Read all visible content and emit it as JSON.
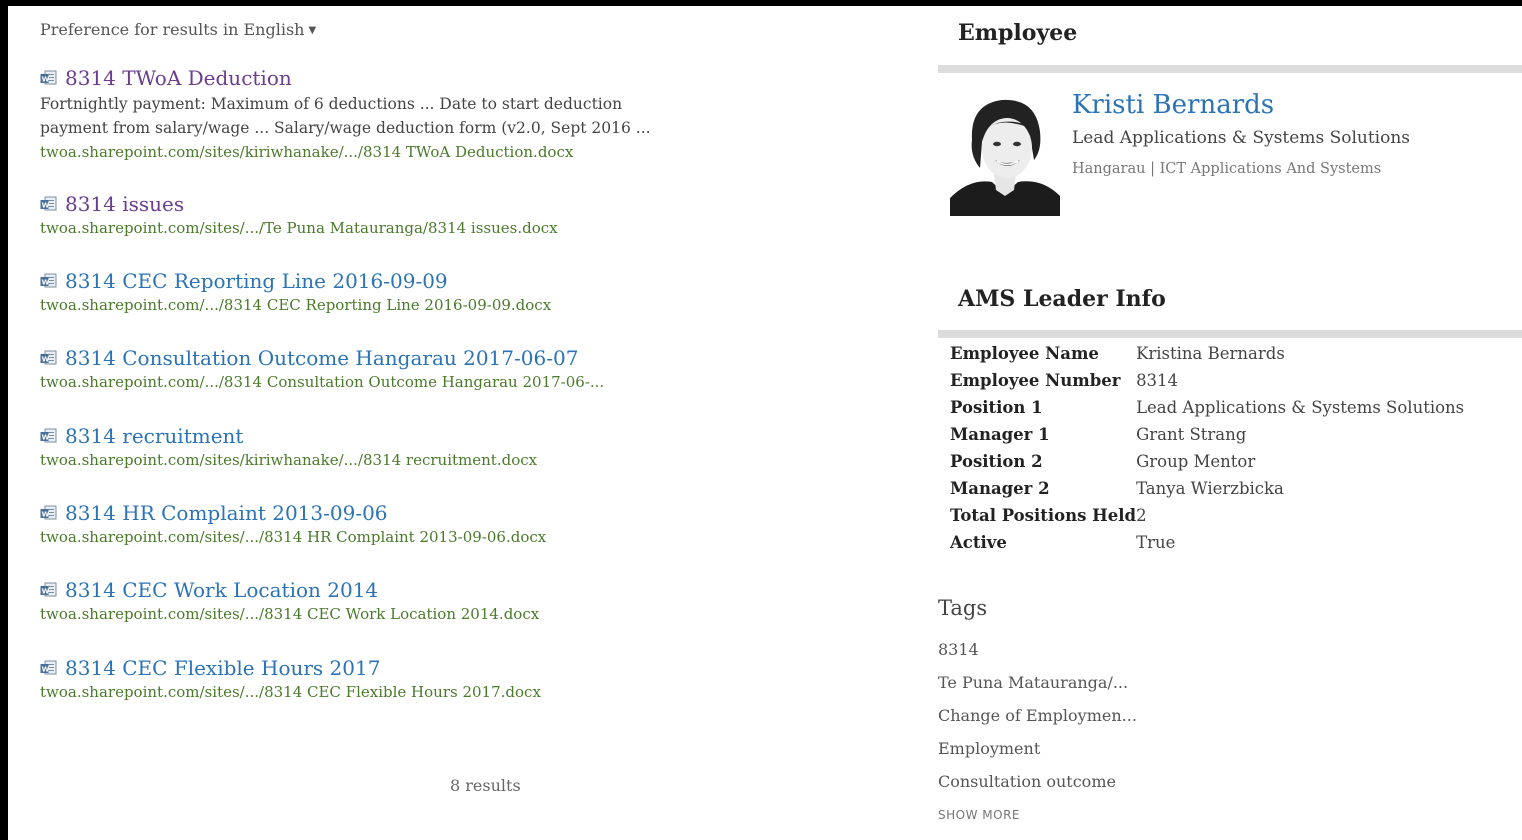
{
  "results_pane": {
    "preference_label": "Preference for results in English",
    "results": [
      {
        "title": "8314 TWoA Deduction",
        "visited": true,
        "snippet": [
          "Fortnightly payment: Maximum of 6 deductions ... Date to start deduction",
          "payment from salary/wage ... Salary/wage deduction form (v2.0, Sept 2016 ..."
        ],
        "url": "twoa.sharepoint.com/sites/kiriwhanake/.../8314 TWoA Deduction.docx"
      },
      {
        "title": "8314 issues",
        "visited": true,
        "snippet": [],
        "url": "twoa.sharepoint.com/sites/.../Te Puna Matauranga/8314 issues.docx"
      },
      {
        "title": "8314 CEC Reporting Line 2016-09-09",
        "visited": false,
        "snippet": [],
        "url": "twoa.sharepoint.com/.../8314 CEC Reporting Line 2016-09-09.docx"
      },
      {
        "title": "8314 Consultation Outcome Hangarau 2017-06-07",
        "visited": false,
        "snippet": [],
        "url": "twoa.sharepoint.com/.../8314 Consultation Outcome Hangarau 2017-06-..."
      },
      {
        "title": "8314 recruitment",
        "visited": false,
        "snippet": [],
        "url": "twoa.sharepoint.com/sites/kiriwhanake/.../8314 recruitment.docx"
      },
      {
        "title": "8314 HR Complaint 2013-09-06",
        "visited": false,
        "snippet": [],
        "url": "twoa.sharepoint.com/sites/.../8314 HR Complaint 2013-09-06.docx"
      },
      {
        "title": "8314 CEC Work Location 2014",
        "visited": false,
        "snippet": [],
        "url": "twoa.sharepoint.com/sites/.../8314 CEC Work Location 2014.docx"
      },
      {
        "title": "8314 CEC Flexible Hours 2017",
        "visited": false,
        "snippet": [],
        "url": "twoa.sharepoint.com/sites/.../8314 CEC Flexible Hours 2017.docx"
      }
    ],
    "result_count": "8 results",
    "icon": "word-document-icon"
  },
  "employee_pane": {
    "heading": "Employee",
    "name": "Kristi Bernards",
    "title": "Lead Applications & Systems Solutions",
    "department": "Hangarau | ICT Applications And Systems",
    "ams_heading": "AMS Leader Info",
    "info": [
      {
        "key": "Employee Name",
        "value": "Kristina Bernards"
      },
      {
        "key": "Employee Number",
        "value": "8314"
      },
      {
        "key": "Position 1",
        "value": "Lead Applications & Systems Solutions"
      },
      {
        "key": "Manager 1",
        "value": "Grant Strang"
      },
      {
        "key": "Position 2",
        "value": "Group Mentor"
      },
      {
        "key": "Manager 2",
        "value": "Tanya Wierzbicka"
      },
      {
        "key": "Total Positions Held",
        "value": "2"
      },
      {
        "key": "Active",
        "value": "True"
      }
    ],
    "tags_heading": "Tags",
    "tags": [
      "8314",
      "Te Puna Matauranga/...",
      "Change of Employmen...",
      "Employment",
      "Consultation outcome"
    ],
    "show_more": "SHOW MORE"
  },
  "colors": {
    "link": "#2b73b6",
    "visited_link": "#6a3d8f",
    "url_green": "#4a7a2a",
    "divider": "#dcdcdc"
  }
}
